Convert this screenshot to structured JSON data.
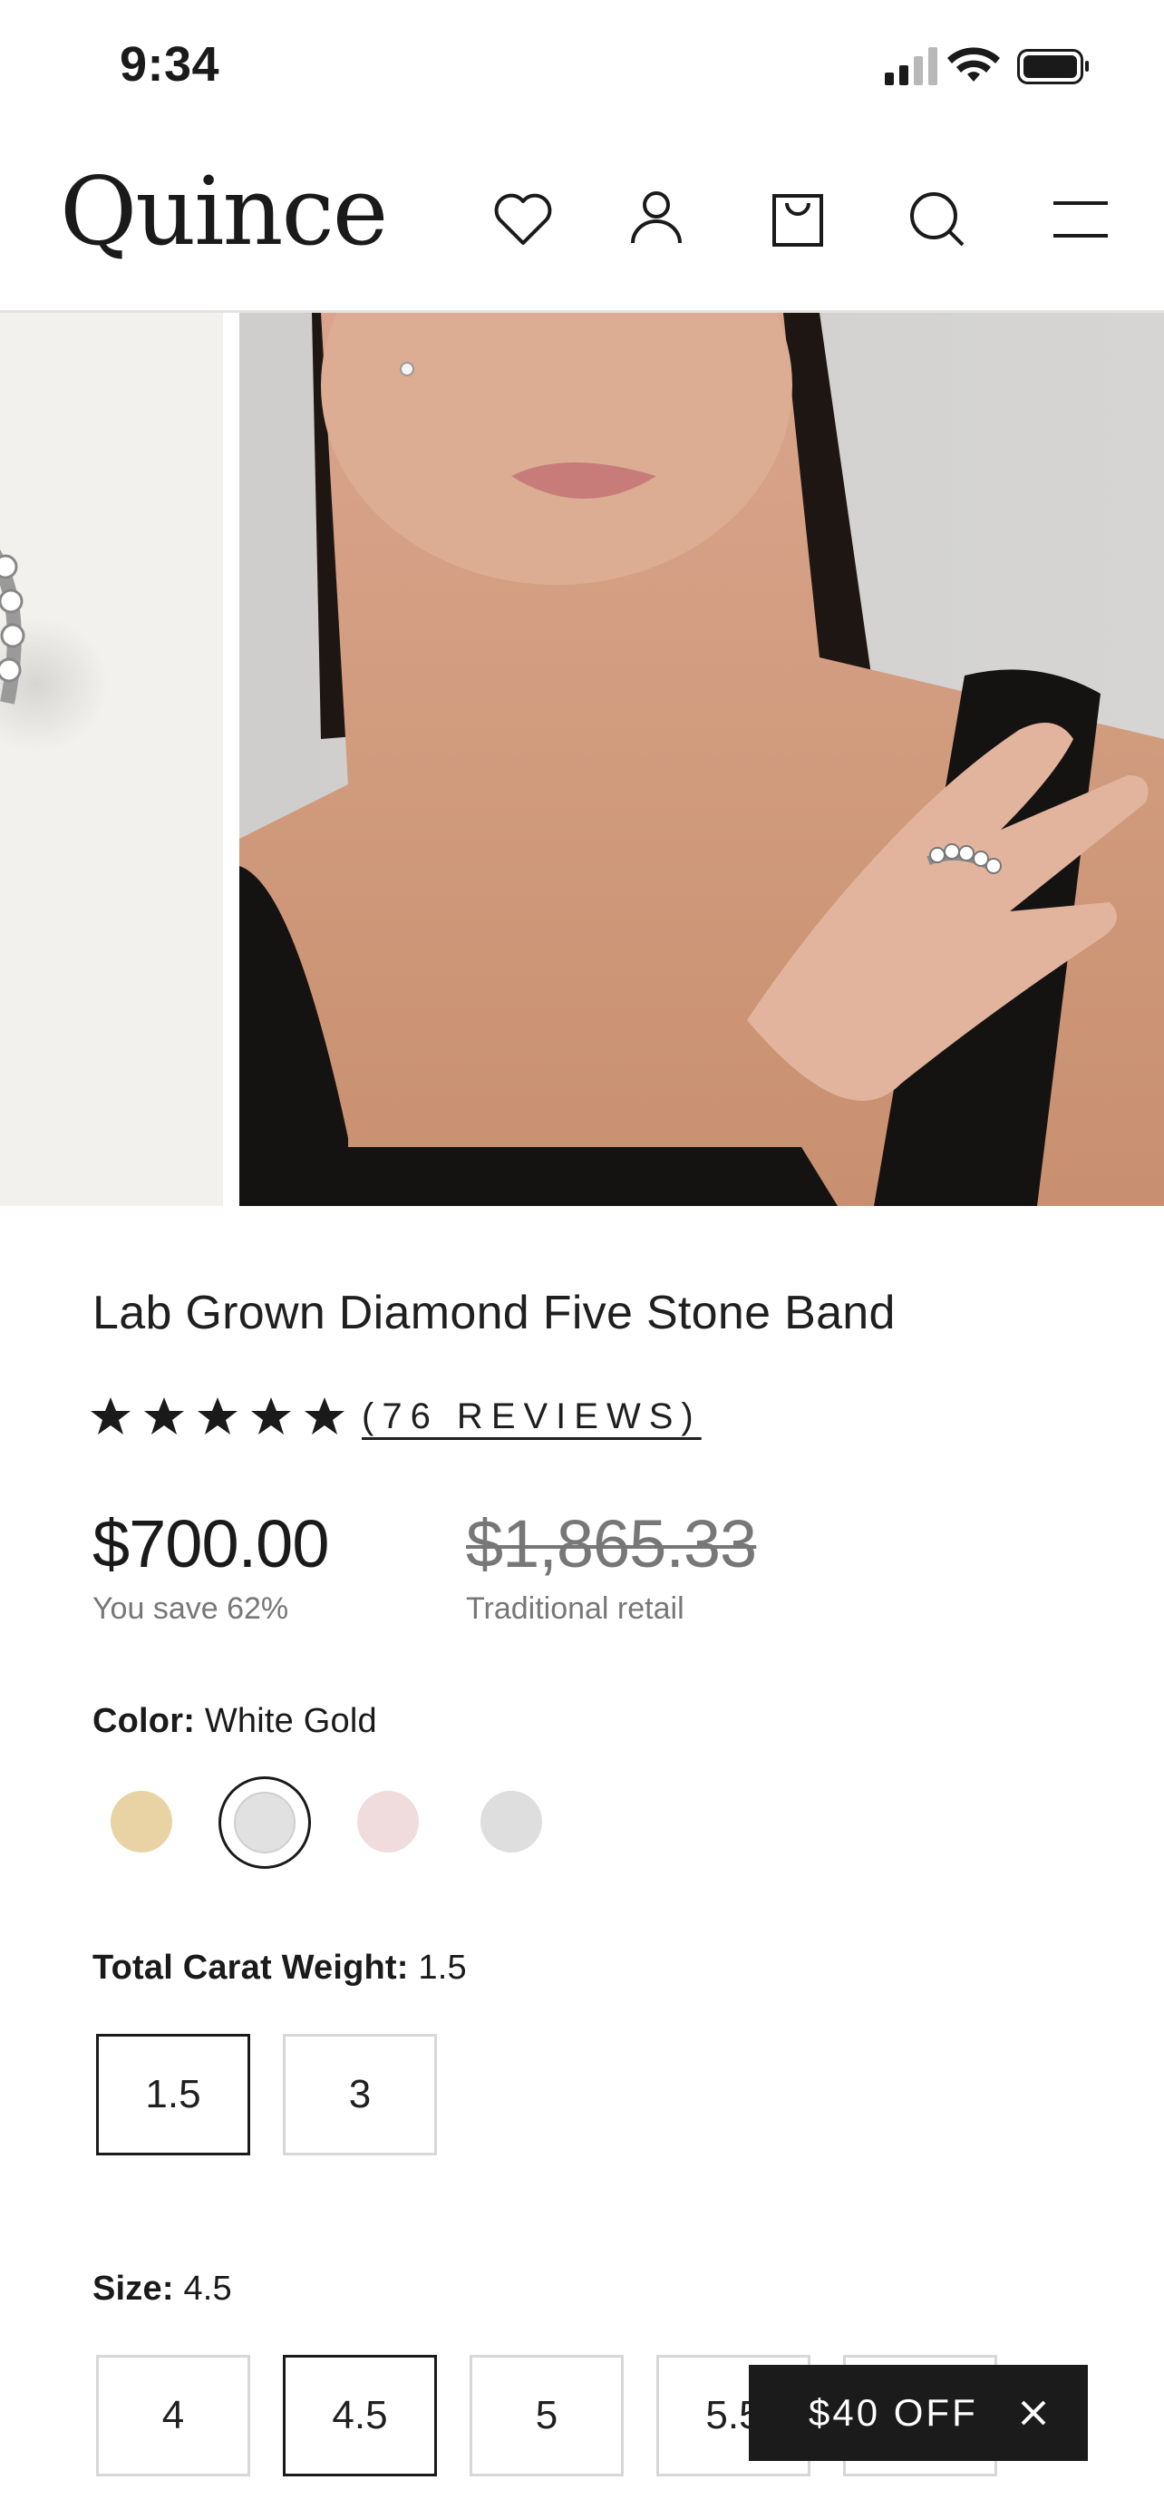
{
  "status_bar": {
    "time": "9:34"
  },
  "header": {
    "logo": "Quince",
    "icons": [
      "heart-icon",
      "account-icon",
      "bag-icon",
      "search-icon",
      "menu-icon"
    ]
  },
  "product": {
    "title": "Lab Grown Diamond Five Stone Band",
    "rating_stars": 5,
    "reviews_label": "(76 REVIEWS)",
    "price": "$700.00",
    "savings": "You save 62%",
    "retail_price": "$1,865.33",
    "retail_label": "Traditional retail"
  },
  "color": {
    "label": "Color:",
    "selected": "White Gold",
    "swatches": [
      {
        "name": "Yellow Gold",
        "hex": "#e9d3a4"
      },
      {
        "name": "White Gold",
        "hex": "#e1e1e1"
      },
      {
        "name": "Rose Gold",
        "hex": "#f0dcdc"
      },
      {
        "name": "Platinum",
        "hex": "#dedede"
      }
    ]
  },
  "carat": {
    "label": "Total Carat Weight:",
    "selected": "1.5",
    "options": [
      "1.5",
      "3"
    ]
  },
  "size": {
    "label": "Size:",
    "selected": "4.5",
    "options": [
      "4",
      "4.5",
      "5",
      "5.5"
    ]
  },
  "promo": {
    "label": "$40 OFF"
  },
  "colors": {
    "text": "#1a1a1a",
    "muted": "#777777",
    "promo_bg": "#1b1b1b"
  }
}
